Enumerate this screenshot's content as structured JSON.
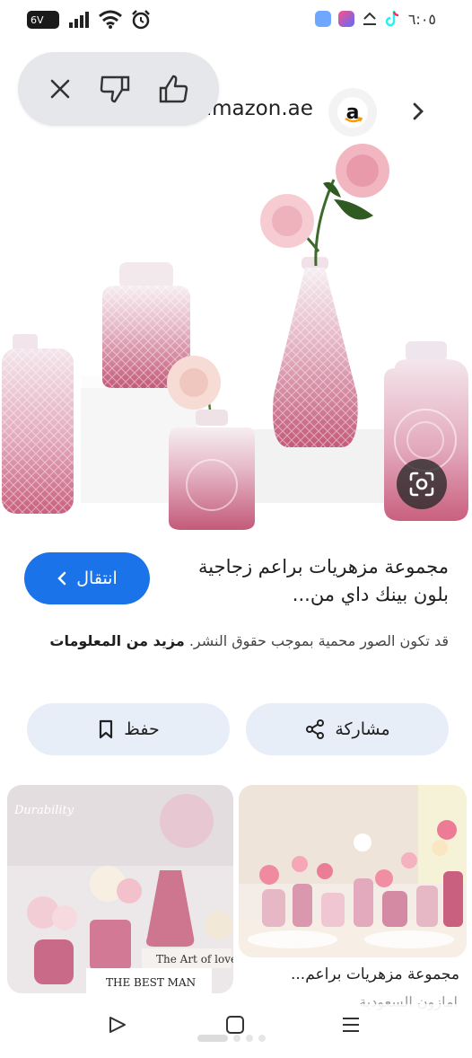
{
  "status_bar": {
    "battery": "6V",
    "time": "٦:٠٥"
  },
  "header": {
    "site": "amazon.ae",
    "logo_letter": "a"
  },
  "feedback": {
    "icons": [
      "close-icon",
      "thumbs-down-icon",
      "thumbs-up-icon"
    ]
  },
  "result": {
    "title": "مجموعة مزهريات براعم زجاجية بلون بينك داي من...",
    "visit_label": "انتقال",
    "notice": "قد تكون الصور محمية بموجب حقوق النشر.",
    "more_info": "مزيد من المعلومات"
  },
  "actions": {
    "share_label": "مشاركة",
    "save_label": "حفظ"
  },
  "related": {
    "left_watermark": "Durability",
    "left_book_1": "The Art of love",
    "left_book_2": "THE BEST MAN",
    "right_title": "مجموعة مزهريات براعم...",
    "right_source": "امازون السعودية"
  },
  "colors": {
    "accent": "#1a73e8",
    "pill_bg": "#e8eef8",
    "pink": "#d98aa6"
  }
}
